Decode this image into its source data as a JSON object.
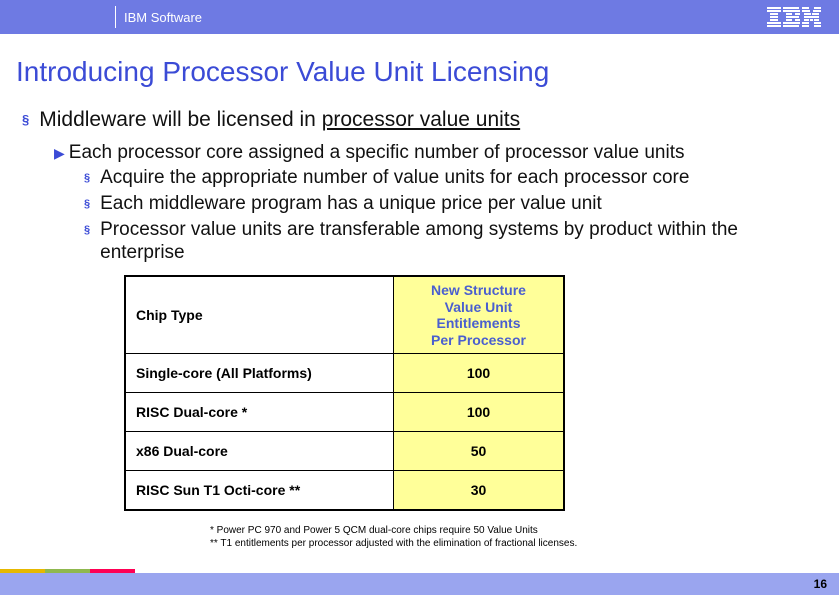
{
  "header": {
    "brand": "IBM Software"
  },
  "title": "Introducing Processor Value Unit Licensing",
  "bullets": {
    "l1_prefix": "Middleware will be licensed in ",
    "l1_underlined": "processor value units",
    "l2": "Each processor core assigned a specific number of processor value units",
    "l3a": "Acquire the appropriate number of value units for each processor core",
    "l3b": "Each middleware program has a unique price per value unit",
    "l3c": "Processor value units are transferable among systems by product within the enterprise"
  },
  "chart_data": {
    "type": "table",
    "columns": [
      "Chip Type",
      "New Structure\nValue Unit\nEntitlements\nPer Processor"
    ],
    "rows": [
      {
        "chip": "Single-core (All Platforms)",
        "value": 100
      },
      {
        "chip": "RISC Dual-core *",
        "value": 100
      },
      {
        "chip": "x86 Dual-core",
        "value": 50
      },
      {
        "chip": "RISC Sun T1 Octi-core **",
        "value": 30
      }
    ]
  },
  "table_header": {
    "col1": "Chip Type",
    "col2_l1": "New Structure",
    "col2_l2": "Value Unit",
    "col2_l3": "Entitlements",
    "col2_l4": "Per Processor"
  },
  "footnotes": {
    "l1": "* Power PC 970 and Power 5 QCM dual-core chips require 50 Value Units",
    "l2": "** T1 entitlements per processor adjusted with the elimination of fractional licenses."
  },
  "page_number": "16"
}
